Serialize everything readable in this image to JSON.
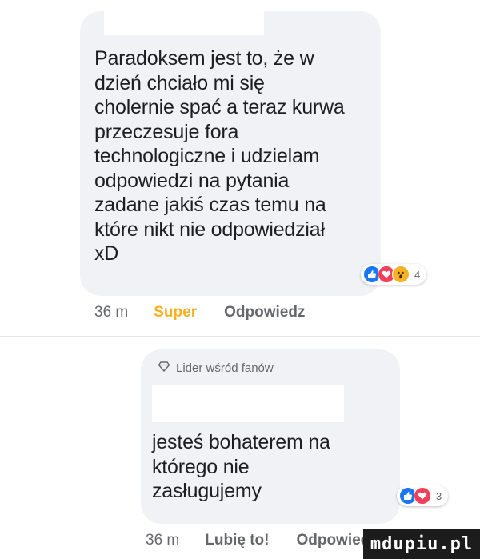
{
  "comments": [
    {
      "text": "Paradoksem jest to, że w\ndzień chciało mi się\ncholernie spać a teraz kurwa\nprzeczesuje fora\ntechnologiczne i udzielam\nodpowiedzi na pytania\nzadane jakiś czas temu na\nktóre nikt nie odpowiedział\nxD",
      "reactions": {
        "icons": [
          "like-icon",
          "love-icon",
          "wow-icon"
        ],
        "count": "4"
      },
      "time": "36 m",
      "reaction_label": "Super",
      "reply_label": "Odpowiedz"
    },
    {
      "badge": "Lider wśród fanów",
      "text": "jesteś bohaterem na\nktórego nie\nzasługujemy",
      "reactions": {
        "icons": [
          "like-icon",
          "love-icon"
        ],
        "count": "3"
      },
      "time": "36 m",
      "reaction_label": "Lubię to!",
      "reply_label": "Odpowiedz"
    }
  ],
  "watermark": "mdupiu.pl",
  "colors": {
    "bubble": "#f0f2f5",
    "like": "#1877f2",
    "love": "#f33e58",
    "wow": "#f7b125",
    "meta": "#65676b"
  }
}
